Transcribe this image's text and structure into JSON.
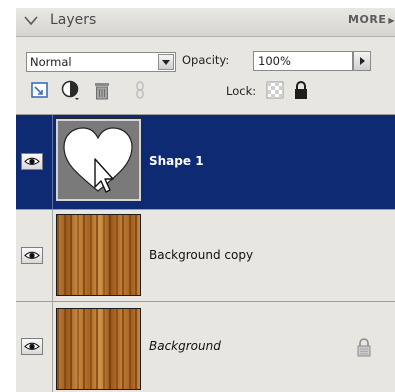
{
  "panel": {
    "title": "Layers",
    "more_label": "MORE",
    "more_arrow": "▶"
  },
  "controls": {
    "blend_mode": "Normal",
    "opacity_label": "Opacity:",
    "opacity_value": "100%",
    "lock_label": "Lock:"
  },
  "toolbar": {
    "icons": [
      "new-layer-icon",
      "adjustment-layer-icon",
      "trash-icon",
      "link-icon",
      "lock-transparency-icon",
      "lock-all-icon"
    ]
  },
  "layers": [
    {
      "name": "Shape 1",
      "visible": true,
      "selected": true,
      "locked": false,
      "italic": false
    },
    {
      "name": "Background copy",
      "visible": true,
      "selected": false,
      "locked": false,
      "italic": false
    },
    {
      "name": "Background",
      "visible": true,
      "selected": false,
      "locked": true,
      "italic": true
    }
  ],
  "colors": {
    "selected_row": "#0e2a73",
    "panel_bg": "#e8e6e1"
  }
}
